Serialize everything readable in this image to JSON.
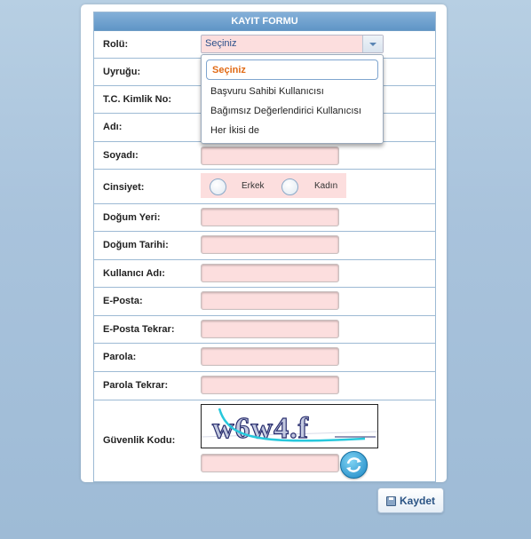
{
  "form": {
    "title": "KAYIT FORMU",
    "role": {
      "label": "Rolü:",
      "selected": "Seçiniz"
    },
    "nationality": {
      "label": "Uyruğu:"
    },
    "tc_id": {
      "label": "T.C. Kimlik No:"
    },
    "name": {
      "label": "Adı:"
    },
    "surname": {
      "label": "Soyadı:"
    },
    "gender": {
      "label": "Cinsiyet:",
      "options": [
        "Erkek",
        "Kadın"
      ]
    },
    "birth_place": {
      "label": "Doğum Yeri:"
    },
    "birth_date": {
      "label": "Doğum Tarihi:"
    },
    "username": {
      "label": "Kullanıcı Adı:"
    },
    "email": {
      "label": "E-Posta:"
    },
    "email_confirm": {
      "label": "E-Posta Tekrar:"
    },
    "password": {
      "label": "Parola:"
    },
    "password_confirm": {
      "label": "Parola Tekrar:"
    },
    "captcha": {
      "label": "Güvenlik Kodu:",
      "text": "w6w4.f"
    }
  },
  "role_dropdown": {
    "options": [
      "Seçiniz",
      "Başvuru Sahibi Kullanıcısı",
      "Bağımsız Değerlendirici Kullanıcısı",
      "Her İkisi de"
    ]
  },
  "save_button": {
    "label": "Kaydet"
  },
  "colors": {
    "header": "#6a9ecd",
    "input_bg": "#fcdede",
    "selected_option": "#e16b16",
    "grid_line": "#9dbad4"
  }
}
